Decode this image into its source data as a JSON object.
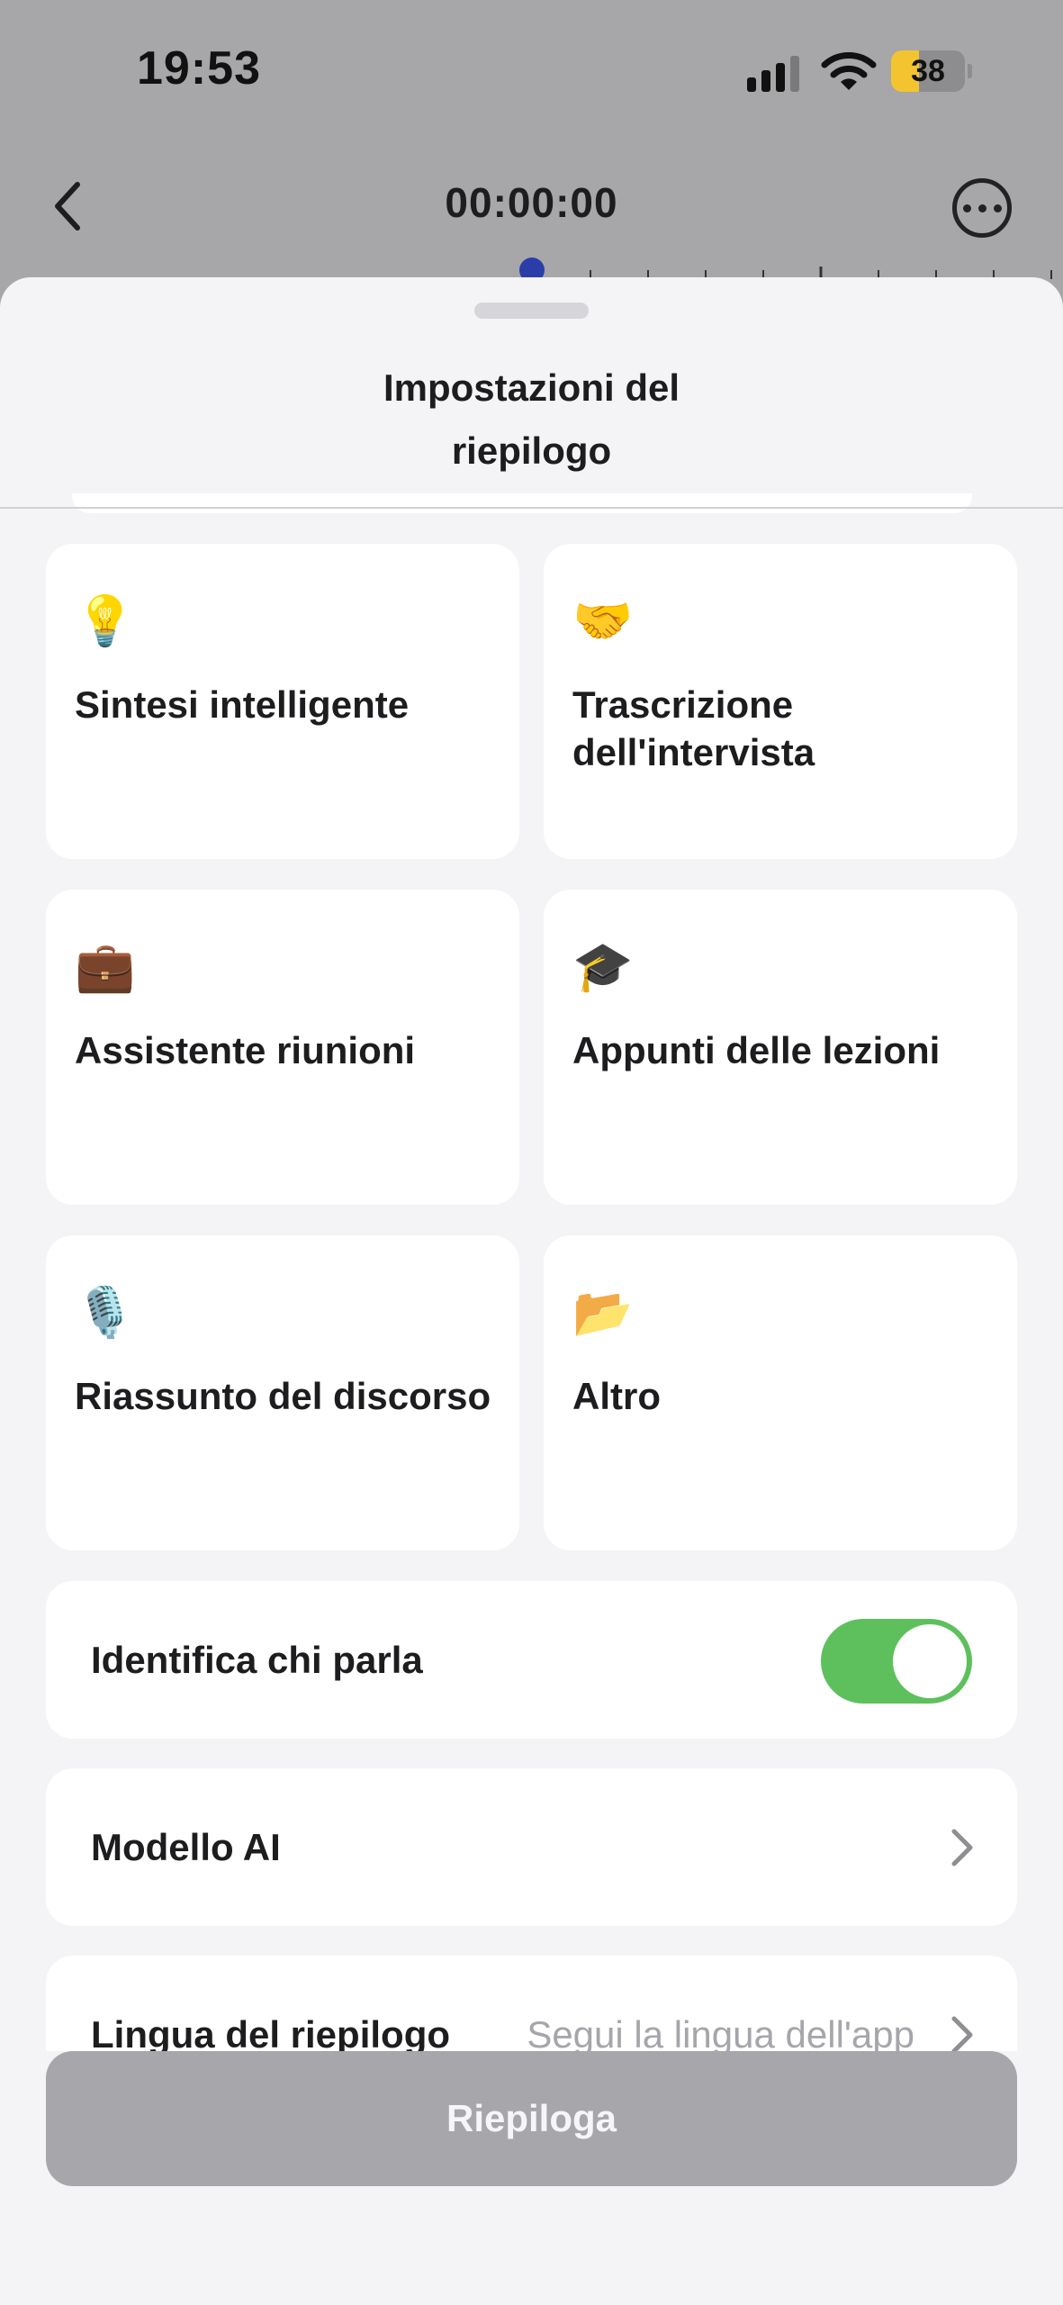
{
  "status_bar": {
    "time": "19:53",
    "battery": "38",
    "battery_level": 0.38
  },
  "header": {
    "timer": "00:00:00"
  },
  "sheet": {
    "title_line1": "Impostazioni del",
    "title_line2": "riepilogo",
    "templates": [
      {
        "icon": "lightbulb-icon",
        "emoji": "💡",
        "label": "Sintesi intelligente"
      },
      {
        "icon": "handshake-icon",
        "emoji": "🤝",
        "label": "Trascrizione dell'intervista"
      },
      {
        "icon": "briefcase-icon",
        "emoji": "💼",
        "label": "Assistente riunioni"
      },
      {
        "icon": "graduation-cap-icon",
        "emoji": "🎓",
        "label": "Appunti delle lezioni"
      },
      {
        "icon": "microphone-icon",
        "emoji": "🎙️",
        "label": "Riassunto del discorso"
      },
      {
        "icon": "folder-icon",
        "emoji": "📂",
        "label": "Altro"
      }
    ],
    "speaker_id": {
      "label": "Identifica chi parla",
      "enabled": true
    },
    "ai_model": {
      "label": "Modello AI"
    },
    "summary_language": {
      "label": "Lingua del riepilogo",
      "value": "Segui la lingua dell'app"
    },
    "summarize_button": "Riepiloga"
  },
  "colors": {
    "toggle_on": "#5dc05c",
    "button_disabled": "#a6a6ab",
    "playhead": "#2b3ea8",
    "battery": "#f4c430"
  }
}
